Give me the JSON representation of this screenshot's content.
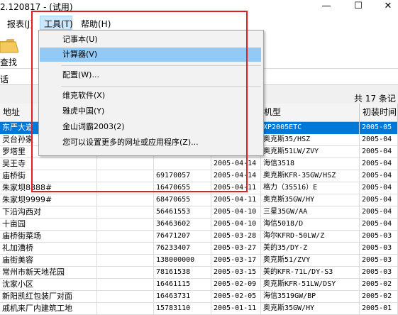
{
  "window": {
    "title": "2.120817 - (试用)",
    "minimize_glyph": "—",
    "maximize_glyph": "☐",
    "close_glyph": "✕"
  },
  "menubar": {
    "items": [
      "报表(J)",
      "工具(T)",
      "帮助(H)"
    ]
  },
  "toolbar": {
    "search_label": "查找",
    "folder_icon": "folder-icon"
  },
  "subbar": {
    "label": "话"
  },
  "summary": {
    "count_text": "共 17 条记"
  },
  "tools_menu": {
    "items": [
      {
        "label": "记事本(U)"
      },
      {
        "label": "计算器(V)"
      },
      {
        "label": "配置(W)..."
      },
      {
        "label": "维克软件(X)"
      },
      {
        "label": "雅虎中国(Y)"
      },
      {
        "label": "金山词霸2003(2)"
      },
      {
        "label": "您可以设置更多的网址或应用程序(Z)..."
      }
    ],
    "highlighted_index": 1
  },
  "table": {
    "headers": [
      "地址",
      "",
      "",
      "",
      "机型",
      "初装时间"
    ],
    "rows": [
      [
        "东严大道",
        "",
        "",
        "",
        "XP2005ETC",
        "2005-05"
      ],
      [
        "灵台孙家",
        "",
        "",
        "",
        "奥克斯35/HSZ",
        "2005-04"
      ],
      [
        "罗塔里",
        "",
        "",
        "",
        "奥克斯51LW/ZVY",
        "2005-04"
      ],
      [
        "吴王寺",
        "",
        "",
        "2005-04-14",
        "海信3518",
        "2005-04"
      ],
      [
        "庙桥街",
        "",
        "69170057",
        "2005-04-14",
        "奥克斯KFR-35GW/HSZ",
        "2005-04"
      ],
      [
        "朱家坝8888#",
        "",
        "16470655",
        "2005-04-11",
        "格力（35516）E",
        "2005-04"
      ],
      [
        "朱家坝9999#",
        "",
        "68470655",
        "2005-04-11",
        "奥克斯35GW/HY",
        "2005-04"
      ],
      [
        "下沿沟西对",
        "",
        "56461553",
        "2005-04-10",
        "三星35GW/AA",
        "2005-04"
      ],
      [
        "十亩园",
        "",
        "36463602",
        "2005-04-10",
        "海信5018/D",
        "2005-04"
      ],
      [
        "庙桥街菜场",
        "",
        "76471207",
        "2005-03-28",
        "海尔KFRD-50LW/Z",
        "2005-03"
      ],
      [
        "礼加漕桥",
        "",
        "76233407",
        "2005-03-27",
        "美的35/DY-Z",
        "2005-03"
      ],
      [
        "庙街美容",
        "",
        "138000000",
        "2005-03-17",
        "奥克斯51/ZVY",
        "2005-03"
      ],
      [
        "常州市新天地花园",
        "",
        "78161538",
        "2005-03-15",
        "美的KFR-71L/DY-S3",
        "2005-03"
      ],
      [
        "沈家小区",
        "",
        "16461115",
        "2005-02-09",
        "奥克斯KFR-51LW/DSY",
        "2005-02"
      ],
      [
        "新阳凯红包装厂对面",
        "",
        "16463731",
        "2005-02-05",
        "海信3519GW/BP",
        "2005-02"
      ],
      [
        "戚机来厂内建筑工地",
        "",
        "15783110",
        "2005-01-11",
        "奥克斯35GW/HY",
        "2005-01"
      ]
    ]
  }
}
